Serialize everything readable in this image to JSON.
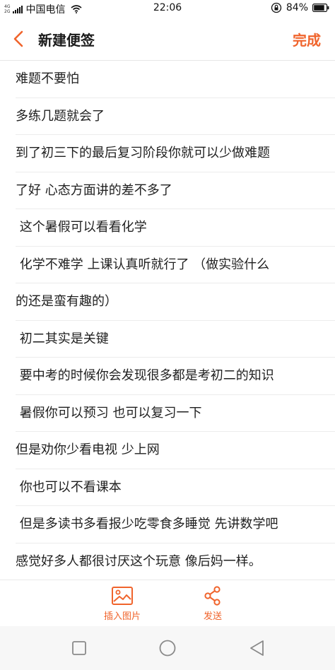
{
  "status_bar": {
    "net_type_top": "4G",
    "net_type_bottom": "2G",
    "carrier": "中国电信",
    "time": "22:06",
    "battery": "84%"
  },
  "header": {
    "title": "新建便签",
    "done_label": "完成"
  },
  "note": {
    "lines": [
      "难题不要怕",
      "多练几题就会了",
      "到了初三下的最后复习阶段你就可以少做难题",
      "了好 心态方面讲的差不多了",
      " 这个暑假可以看看化学",
      " 化学不难学 上课认真听就行了 （做实验什么",
      "的还是蛮有趣的）",
      " 初二其实是关键",
      " 要中考的时候你会发现很多都是考初二的知识",
      " 暑假你可以预习 也可以复习一下",
      "但是劝你少看电视 少上网",
      " 你也可以不看课本",
      " 但是多读书多看报少吃零食多睡觉 先讲数学吧",
      "感觉好多人都很讨厌这个玩意 像后妈一样。"
    ]
  },
  "toolbar": {
    "insert_image_label": "插入图片",
    "send_label": "发送"
  },
  "icons": {
    "back": "chevron-left-icon",
    "insert_image": "image-icon",
    "send": "share-icon",
    "nav_recent": "square-icon",
    "nav_home": "circle-icon",
    "nav_back": "triangle-back-icon"
  },
  "colors": {
    "accent": "#f0642c",
    "divider": "#ececec"
  }
}
